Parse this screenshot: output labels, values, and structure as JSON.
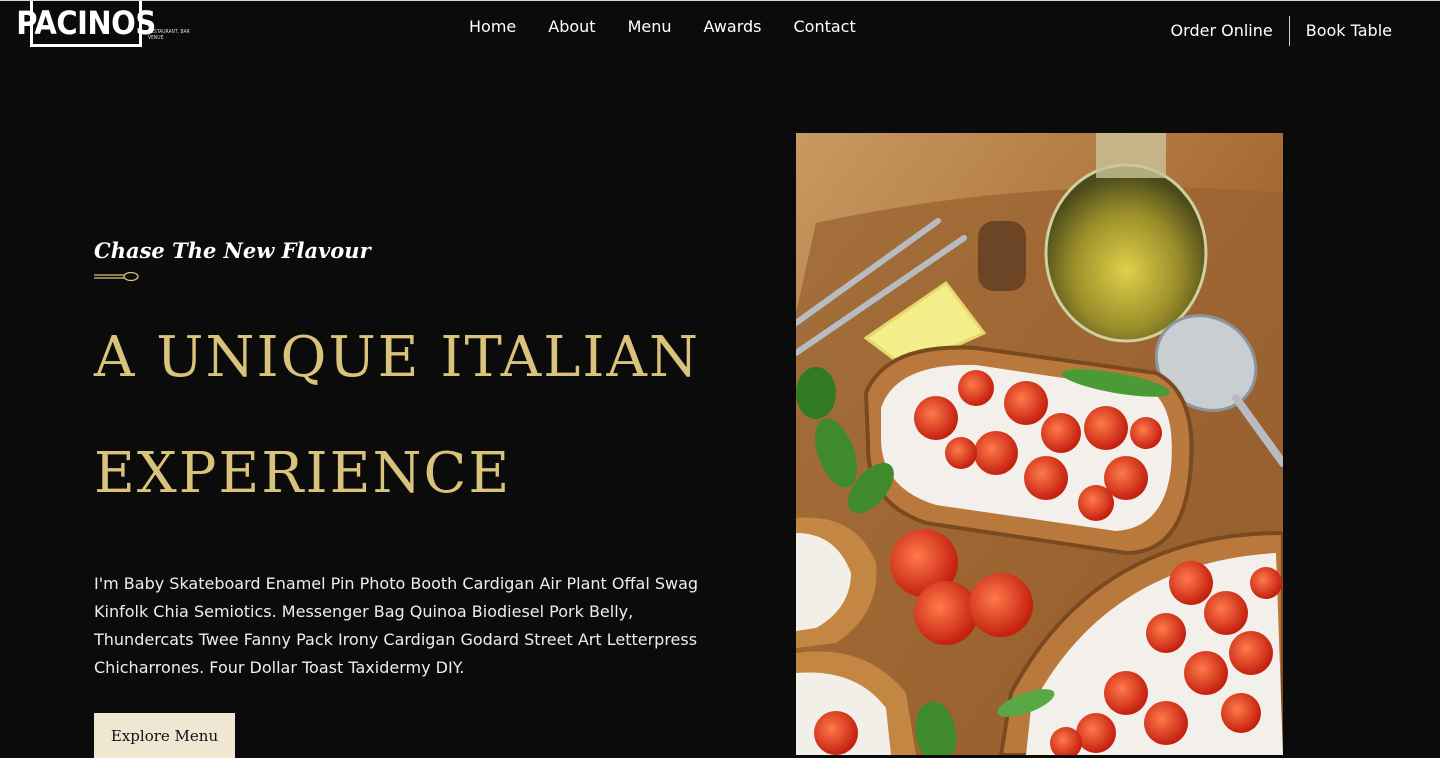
{
  "brand": {
    "name": "PACINOS",
    "tagline": "RESTAURANT, BAR VENUE"
  },
  "nav": {
    "items": [
      "Home",
      "About",
      "Menu",
      "Awards",
      "Contact"
    ],
    "order_online": "Order Online",
    "book_table": "Book Table"
  },
  "hero": {
    "eyebrow": "Chase The New Flavour",
    "headline_line1": "A UNIQUE ITALIAN",
    "headline_line2": "EXPERIENCE",
    "body": "I'm Baby Skateboard Enamel Pin Photo Booth Cardigan Air Plant Offal Swag Kinfolk Chia Semiotics. Messenger Bag Quinoa Biodiesel Pork Belly, Thundercats Twee Fanny Pack Irony Cardigan Godard Street Art Letterpress Chicharrones. Four Dollar Toast Taxidermy DIY.",
    "cta": "Explore Menu"
  },
  "colors": {
    "background": "#0b0b0b",
    "accent_gold": "#d9c27a",
    "button_bg": "#efe7d2"
  }
}
